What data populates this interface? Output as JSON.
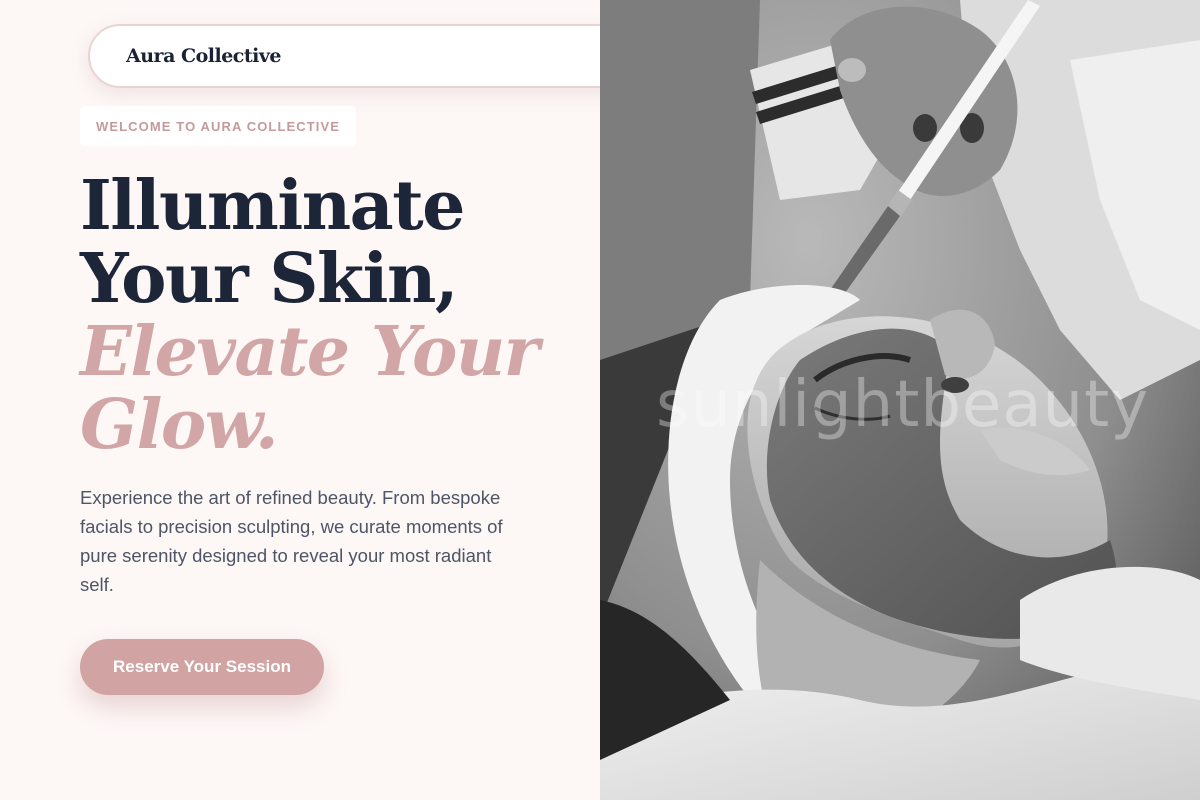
{
  "header": {
    "brand": "Aura Collective"
  },
  "hero": {
    "badge": "WELCOME TO AURA COLLECTIVE",
    "headline_line1": "Illuminate",
    "headline_line2": "Your Skin,",
    "headline_line3": "Elevate Your",
    "headline_line4": "Glow.",
    "intro": "Experience the art of refined beauty. From bespoke facials to precision sculpting, we curate moments of pure serenity designed to reveal your most radiant self.",
    "cta_label": "Reserve Your Session"
  },
  "photo": {
    "watermark": "sunlightbeauty"
  },
  "colors": {
    "background": "#fdf7f6",
    "headline": "#1d2638",
    "accent": "#d2a5a6",
    "button": "#d1a3a3",
    "text": "#4e5566"
  }
}
